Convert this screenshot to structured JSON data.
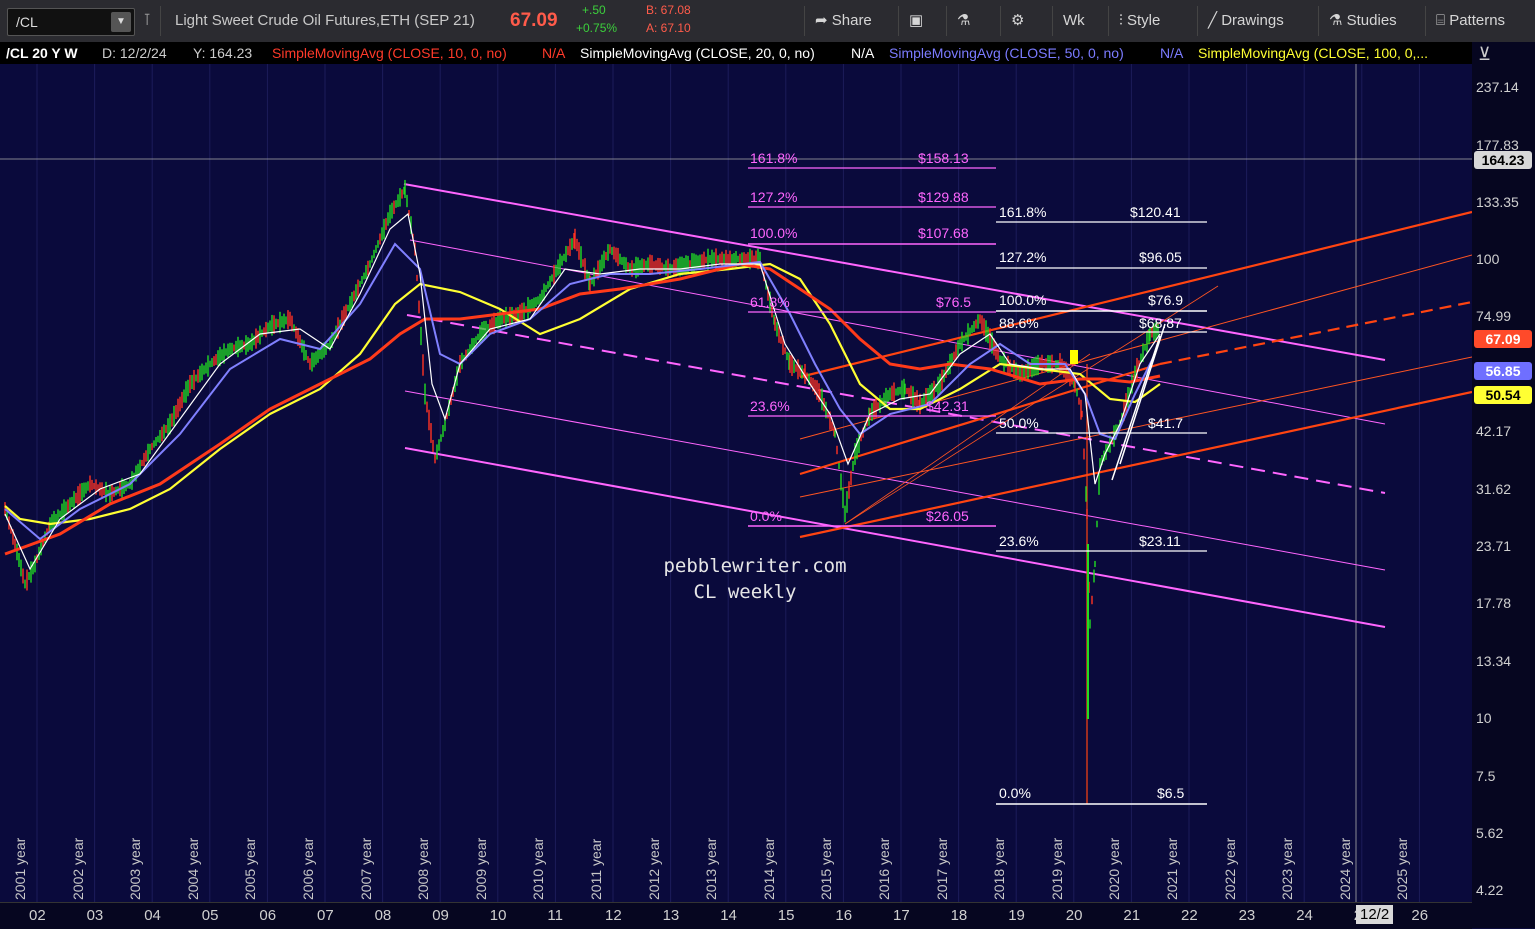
{
  "toolbar": {
    "symbol": "/CL",
    "instrument": "Light Sweet Crude Oil Futures,ETH (SEP 21)",
    "last": "67.09",
    "change": "+.50",
    "change_pct": "+0.75%",
    "bid": "B: 67.08",
    "ask": "A: 67.10",
    "share": "Share",
    "period": "Wk",
    "style": "Style",
    "drawings": "Drawings",
    "studies": "Studies",
    "patterns": "Patterns"
  },
  "studybar": {
    "symbol": "/CL 20 Y W",
    "date": "D: 12/2/24",
    "y": "Y: 164.23",
    "sma10": "SimpleMovingAvg (CLOSE, 10, 0, no)",
    "sma20": "SimpleMovingAvg (CLOSE, 20, 0, no)",
    "sma50": "SimpleMovingAvg (CLOSE, 50, 0, no)",
    "sma100": "SimpleMovingAvg (CLOSE, 100, 0,...",
    "na": "N/A"
  },
  "yaxis": {
    "ticks": [
      "237.14",
      "177.83",
      "133.35",
      "100",
      "74.99",
      "42.17",
      "31.62",
      "23.71",
      "17.78",
      "13.34",
      "10",
      "7.5",
      "5.62",
      "4.22"
    ],
    "crosshair": "164.23",
    "price": "67.09",
    "sma50": "56.85",
    "sma100": "50.54"
  },
  "xaxis": {
    "ticks": [
      "02",
      "03",
      "04",
      "05",
      "06",
      "07",
      "08",
      "09",
      "10",
      "11",
      "12",
      "13",
      "14",
      "15",
      "16",
      "17",
      "18",
      "19",
      "20",
      "21",
      "22",
      "23",
      "24",
      "25",
      "26"
    ],
    "cursor": "12/2"
  },
  "year_labels": [
    "2001 year",
    "2002 year",
    "2003 year",
    "2004 year",
    "2005 year",
    "2006 year",
    "2007 year",
    "2008 year",
    "2009 year",
    "2010 year",
    "2011 year",
    "2012 year",
    "2013 year",
    "2014 year",
    "2015 year",
    "2016 year",
    "2017 year",
    "2018 year",
    "2019 year",
    "2020 year",
    "2021 year",
    "2022 year",
    "2023 year",
    "2024 year",
    "2025 year"
  ],
  "fib_pink": [
    {
      "pct": "161.8%",
      "price": "$158.13"
    },
    {
      "pct": "127.2%",
      "price": "$129.88"
    },
    {
      "pct": "100.0%",
      "price": "$107.68"
    },
    {
      "pct": "61.8%",
      "price": "$76.5"
    },
    {
      "pct": "23.6%",
      "price": "$42.31"
    },
    {
      "pct": "0.0%",
      "price": "$26.05"
    }
  ],
  "fib_white": [
    {
      "pct": "161.8%",
      "price": "$120.41"
    },
    {
      "pct": "127.2%",
      "price": "$96.05"
    },
    {
      "pct": "100.0%",
      "price": "$76.9"
    },
    {
      "pct": "88.6%",
      "price": "$68.87"
    },
    {
      "pct": "50.0%",
      "price": "$41.7"
    },
    {
      "pct": "23.6%",
      "price": "$23.11"
    },
    {
      "pct": "0.0%",
      "price": "$6.5"
    }
  ],
  "watermark": {
    "line1": "pebblewriter.com",
    "line2": "CL weekly"
  },
  "colors": {
    "sma10": "#ffffff",
    "sma20": "#7b7bff",
    "sma50": "#ff4422",
    "sma100": "#ffff33",
    "fib_pink": "#ff66ff",
    "channel": "#ff66ff",
    "trend": "#ff4411"
  }
}
